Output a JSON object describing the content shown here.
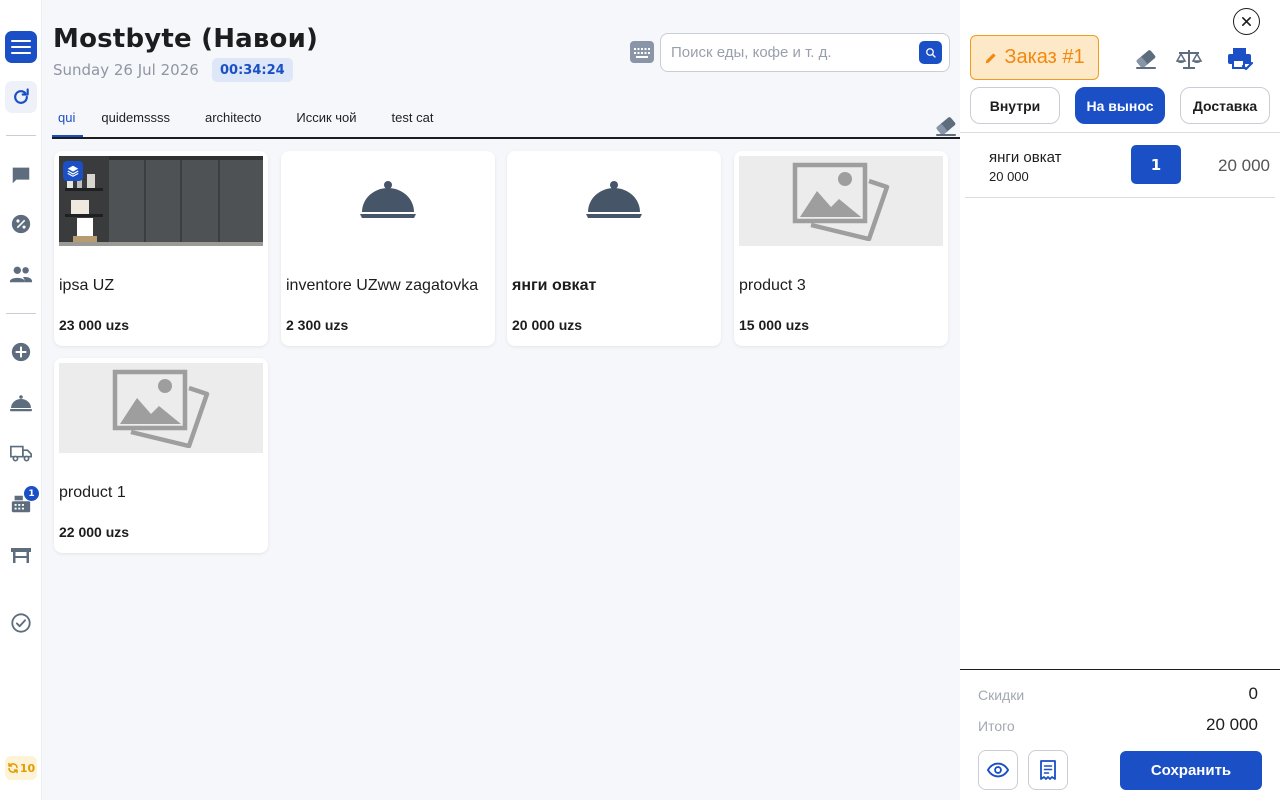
{
  "header": {
    "title": "Mostbyte (Навои)",
    "date": "Sunday 26 Jul 2026",
    "timer": "00:34:24"
  },
  "search": {
    "placeholder": "Поиск еды, кофе и т. д."
  },
  "sidebar": {
    "icons": [
      "menu-icon",
      "refresh-icon",
      "chat-icon",
      "percent-icon",
      "users-icon",
      "add-icon",
      "cloche-icon",
      "delivery-truck-icon",
      "cash-register-icon",
      "table-icon",
      "check-circle-icon"
    ],
    "register_badge": "1",
    "sync_count": "10"
  },
  "tabs": [
    {
      "label": "qui",
      "active": true
    },
    {
      "label": "quidemssss",
      "active": false
    },
    {
      "label": "architecto",
      "active": false
    },
    {
      "label": "Иссик чой",
      "active": false
    },
    {
      "label": "test cat",
      "active": false
    }
  ],
  "products": [
    {
      "name": "ipsa UZ",
      "price": "23 000 uzs",
      "image": "photo"
    },
    {
      "name": "inventore UZww zagatovka",
      "price": "2 300 uzs",
      "image": "cloche"
    },
    {
      "name": "янги овкат",
      "price": "20 000 uzs",
      "image": "cloche"
    },
    {
      "name": "product 3",
      "price": "15 000 uzs",
      "image": "placeholder"
    },
    {
      "name": "product 1",
      "price": "22 000 uzs",
      "image": "placeholder"
    }
  ],
  "order": {
    "label": "Заказ #1",
    "types": [
      {
        "label": "Внутри",
        "active": false
      },
      {
        "label": "На вынос",
        "active": true
      },
      {
        "label": "Доставка",
        "active": false
      }
    ],
    "items": [
      {
        "name": "янги овкат",
        "unit_price": "20 000",
        "qty": "1",
        "total": "20 000"
      }
    ],
    "discount_label": "Скидки",
    "discount_value": "0",
    "total_label": "Итого",
    "total_value": "20 000",
    "save_label": "Сохранить"
  },
  "colors": {
    "accent": "#1a4fc5",
    "order_orange": "#f2880f",
    "background": "#f6f7fb"
  }
}
